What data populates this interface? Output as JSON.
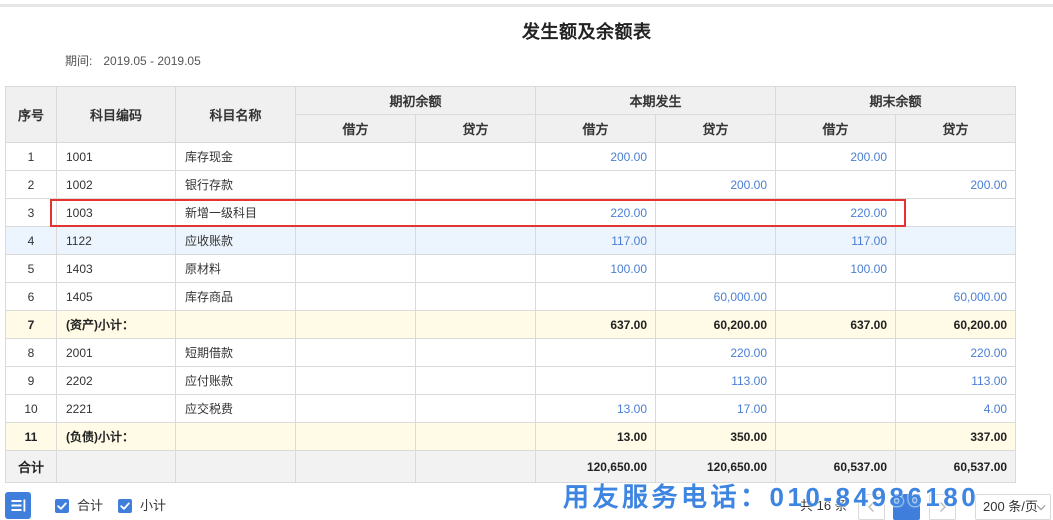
{
  "report": {
    "title": "发生额及余额表",
    "period_label": "期间:",
    "period_value": "2019.05 - 2019.05"
  },
  "table": {
    "headers": {
      "seq": "序号",
      "code": "科目编码",
      "name": "科目名称",
      "opening": "期初余额",
      "period": "本期发生",
      "closing": "期末余额",
      "debit": "借方",
      "credit": "贷方"
    },
    "rows": [
      {
        "seq": "1",
        "code": "1001",
        "name": "库存现金",
        "values": [
          "",
          "",
          "200.00",
          "",
          "200.00",
          ""
        ]
      },
      {
        "seq": "2",
        "code": "1002",
        "name": "银行存款",
        "values": [
          "",
          "",
          "",
          "200.00",
          "",
          "200.00"
        ]
      },
      {
        "seq": "3",
        "code": "1003",
        "name": "新增一级科目",
        "values": [
          "",
          "",
          "220.00",
          "",
          "220.00",
          ""
        ],
        "marked": true
      },
      {
        "seq": "4",
        "code": "1122",
        "name": "应收账款",
        "values": [
          "",
          "",
          "117.00",
          "",
          "117.00",
          ""
        ],
        "hovered": true
      },
      {
        "seq": "5",
        "code": "1403",
        "name": "原材料",
        "values": [
          "",
          "",
          "100.00",
          "",
          "100.00",
          ""
        ]
      },
      {
        "seq": "6",
        "code": "1405",
        "name": "库存商品",
        "values": [
          "",
          "",
          "",
          "60,000.00",
          "",
          "60,000.00"
        ]
      },
      {
        "seq": "7",
        "code": "(资产)小计：",
        "name": "",
        "values": [
          "",
          "",
          "637.00",
          "60,200.00",
          "637.00",
          "60,200.00"
        ],
        "subtotal": true
      },
      {
        "seq": "8",
        "code": "2001",
        "name": "短期借款",
        "values": [
          "",
          "",
          "",
          "220.00",
          "",
          "220.00"
        ]
      },
      {
        "seq": "9",
        "code": "2202",
        "name": "应付账款",
        "values": [
          "",
          "",
          "",
          "113.00",
          "",
          "113.00"
        ]
      },
      {
        "seq": "10",
        "code": "2221",
        "name": "应交税费",
        "values": [
          "",
          "",
          "13.00",
          "17.00",
          "",
          "4.00"
        ]
      },
      {
        "seq": "11",
        "code": "(负债)小计：",
        "name": "",
        "values": [
          "",
          "",
          "13.00",
          "350.00",
          "",
          "337.00"
        ],
        "subtotal": true
      }
    ],
    "total": {
      "label": "合计",
      "values": [
        "",
        "",
        "120,650.00",
        "120,650.00",
        "60,537.00",
        "60,537.00"
      ]
    }
  },
  "footer": {
    "checkboxes": [
      {
        "label": "合计",
        "checked": true
      },
      {
        "label": "小计",
        "checked": true
      }
    ],
    "pagination": {
      "total_text": "共 16 条",
      "page_size": "200 条/页"
    },
    "service_banner": "用友服务电话：010-84986180"
  },
  "icons": {
    "menu_button": "list-collapse-icon",
    "checkbox": "check-icon",
    "prev_page": "chevron-left-icon",
    "next_page": "chevron-right-icon",
    "page_size_dropdown": "chevron-down-icon"
  },
  "colors": {
    "accent": "#3f7fdb",
    "number_blue": "#4a7fd3",
    "subtotal_bg": "#fffbe6",
    "hover_bg": "#ecf4fd",
    "annotation_red": "#e3342f",
    "banner_blue": "#3d85e0",
    "header_bg": "#f0f0f0"
  }
}
